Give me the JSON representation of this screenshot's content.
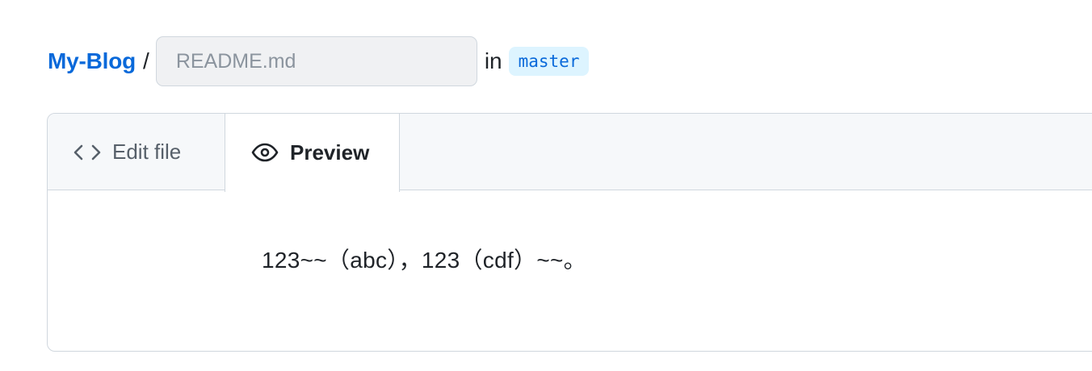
{
  "breadcrumb": {
    "repo": "My-Blog",
    "separator": "/",
    "filename_placeholder": "README.md",
    "filename_value": "",
    "in_label": "in",
    "branch": "master"
  },
  "tabs": [
    {
      "label": "Edit file",
      "icon": "code-icon",
      "active": false
    },
    {
      "label": "Preview",
      "icon": "eye-icon",
      "active": true
    }
  ],
  "preview": {
    "content": "123~~（abc），123（cdf）~~。"
  },
  "colors": {
    "link": "#0969da",
    "badge_bg": "#ddf4ff",
    "border": "#d0d7de",
    "tabbar_bg": "#f6f8fa"
  }
}
